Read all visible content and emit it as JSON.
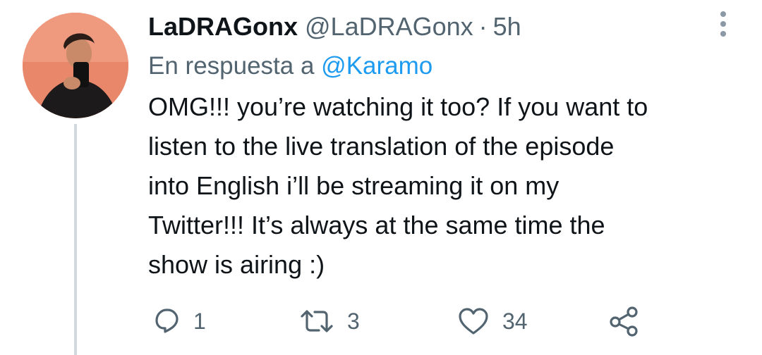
{
  "tweet": {
    "display_name": "LaDRAGonx",
    "handle": "@LaDRAGonx",
    "separator": "·",
    "time": "5h",
    "reply_prefix": "En respuesta a",
    "reply_mention": "@Karamo",
    "body_lines": [
      "OMG!!! you’re watching it too? If you want to",
      "listen to the live translation of the episode",
      "into English i’ll be streaming it on my",
      "Twitter!!! It’s always at the same time the",
      "show is airing :)"
    ],
    "actions": {
      "reply_count": "1",
      "retweet_count": "3",
      "like_count": "34"
    }
  },
  "icons": {
    "more": "more-vertical-icon",
    "reply": "reply-icon",
    "retweet": "retweet-icon",
    "like": "heart-icon",
    "share": "share-icon"
  },
  "colors": {
    "text": "#0f1419",
    "secondary": "#536471",
    "accent": "#1d9bf0",
    "thread_line": "#cfd9de"
  }
}
